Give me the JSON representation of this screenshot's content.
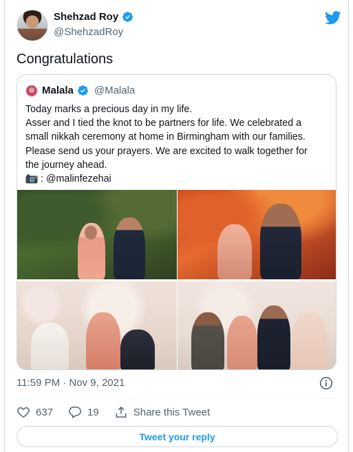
{
  "author": {
    "name": "Shehzad Roy",
    "handle": "@ShehzadRoy",
    "verified": true
  },
  "tweet": {
    "text": "Congratulations",
    "timestamp": "11:59 PM · Nov 9, 2021"
  },
  "quoted": {
    "name": "Malala",
    "handle": "@Malala",
    "verified": true,
    "lines": [
      "Today marks a precious day in my life.",
      "Asser and I tied the knot to be partners for life. We celebrated a",
      "small nikkah ceremony at home in Birmingham with our families.",
      "Please send us your prayers. We are excited to walk together for",
      "the journey ahead."
    ],
    "photo_credit": ": @malinfezehai",
    "photo_icon": "camera-icon"
  },
  "actions": {
    "likes": "637",
    "replies": "19",
    "share_label": "Share this Tweet"
  },
  "reply_button": "Tweet your reply",
  "colors": {
    "brand_blue": "#1d9bf0",
    "text_primary": "#0f1419",
    "text_secondary": "#536471",
    "border": "#cfd9de"
  }
}
